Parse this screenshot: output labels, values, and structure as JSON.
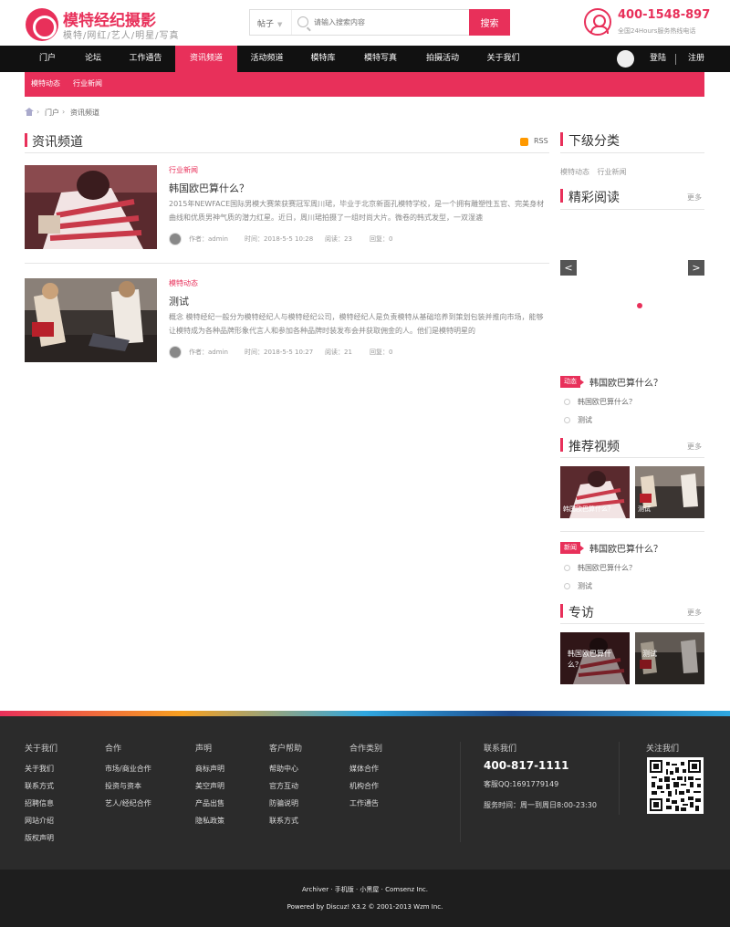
{
  "header": {
    "logo_title": "模特经纪摄影",
    "logo_sub": "模特/网红/艺人/明星/写真",
    "search_type": "帖子",
    "search_placeholder": "请输入搜索内容",
    "search_button": "搜索",
    "phone": "400-1548-897",
    "phone_note": "全国24Hours服务热线电话"
  },
  "nav": {
    "items": [
      "门户",
      "论坛",
      "工作通告",
      "资讯频道",
      "活动频道",
      "模特库",
      "模特写真",
      "拍摄活动",
      "关于我们"
    ],
    "active": "资讯频道",
    "login": "登陆",
    "register": "注册"
  },
  "subnav": {
    "items": [
      "模特动态",
      "行业新闻"
    ]
  },
  "breadcrumb": {
    "items": [
      "门户",
      "资讯频道"
    ]
  },
  "main": {
    "title": "资讯频道",
    "rss": "RSS",
    "articles": [
      {
        "category": "行业新闻",
        "title": "韩国欧巴算什么？",
        "summary": "2015年NEWFACE国际男模大赛荣获赛冠军周川珺，毕业于北京新面孔模特学校，是一个拥有雕塑性五官、完美身材曲线和优质男神气质的潜力红星。近日，周川珺拍摄了一组时尚大片。微卷的韩式发型，一双湿漉",
        "author": "作者：admin",
        "time": "时间：2018-5-5 10:28",
        "views": "阅读：23",
        "replies": "回复：0"
      },
      {
        "category": "模特动态",
        "title": "测试",
        "summary": "概念 模特经纪一般分为模特经纪人与模特经纪公司，模特经纪人是负责模特从基础培养到策划包装并推向市场，能够让模特成为各种品牌形象代言人和参加各种品牌时装发布会并获取佣金的人。他们是模特明星的",
        "author": "作者：admin",
        "time": "时间：2018-5-5 10:27",
        "views": "阅读：21",
        "replies": "回复：0"
      }
    ]
  },
  "sidebar": {
    "subcat_title": "下级分类",
    "subcats": [
      "模特动态",
      "行业新闻"
    ],
    "featured_title": "精彩阅读",
    "more": "更多",
    "slider_prev": "<",
    "slider_next": ">",
    "block1": {
      "tag": "动态",
      "headline": "韩国欧巴算什么？",
      "items": [
        "韩国欧巴算什么？",
        "测试"
      ]
    },
    "video_title": "推荐视频",
    "videos": [
      "韩国欧巴算什么？",
      "测试"
    ],
    "block2": {
      "tag": "新闻",
      "headline": "韩国欧巴算什么？",
      "items": [
        "韩国欧巴算什么？",
        "测试"
      ]
    },
    "interview_title": "专访",
    "interviews": [
      "韩国欧巴算什么？",
      "测试"
    ]
  },
  "footer": {
    "cols": [
      {
        "title": "关于我们",
        "items": [
          "关于我们",
          "联系方式",
          "招聘信息",
          "网站介绍",
          "版权声明"
        ]
      },
      {
        "title": "合作",
        "items": [
          "市场/商业合作",
          "投资与资本",
          "艺人/经纪合作"
        ]
      },
      {
        "title": "声明",
        "items": [
          "商标声明",
          "美空声明",
          "产品出售",
          "隐私政策"
        ]
      },
      {
        "title": "客户帮助",
        "items": [
          "帮助中心",
          "官方互动",
          "防骗说明",
          "联系方式"
        ]
      },
      {
        "title": "合作类别",
        "items": [
          "媒体合作",
          "机构合作",
          "工作通告"
        ]
      }
    ],
    "contact_title": "联系我们",
    "contact_phone": "400-817-1111",
    "contact_qq": "客服QQ:1691779149",
    "contact_time": "服务时间：周一到周日8:00-23:30",
    "follow_title": "关注我们",
    "bottom_line1": "Archiver · 手机版 · 小黑屋 · Comsenz Inc.",
    "bottom_line2": "Powered by Discuz! X3.2  © 2001-2013 Wzm Inc."
  },
  "colors": {
    "accent": "#e8305a",
    "nav_bg": "#111111",
    "footer_bg": "#2b2b2b"
  }
}
